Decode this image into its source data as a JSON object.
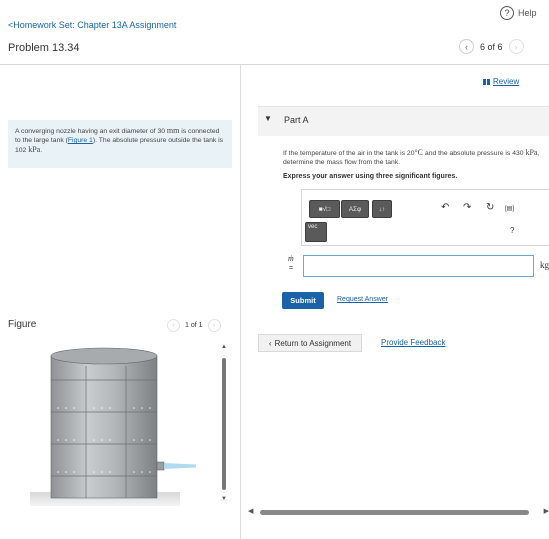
{
  "header": {
    "help_label": "Help",
    "help_icon": "?",
    "breadcrumb": "<Homework Set: Chapter 13A Assignment",
    "problem_title": "Problem 13.34",
    "pager_text": "6 of 6",
    "prev_icon": "‹",
    "next_icon": "›"
  },
  "problem": {
    "text_1": "A converging nozzle having an exit diameter of 30 ",
    "unit_mm": "mm",
    "text_2": " is connected to the large tank (",
    "figure_link": "Figure 1",
    "text_3": "). The absolute pressure outside the tank is 102 ",
    "unit_kpa": "kPa",
    "text_4": "."
  },
  "figure": {
    "label": "Figure",
    "pager_text": "1 of 1",
    "prev_icon": "‹",
    "next_icon": "›"
  },
  "review": {
    "label": "Review"
  },
  "part_a": {
    "caret": "▼",
    "label": "Part A",
    "q_1": "If the temperature of the air in the tank is 20",
    "q_unit_c": "°C",
    "q_2": " and the absolute pressure is 430 ",
    "q_unit_kpa": "kPa",
    "q_3": ", determine the mass flow from the tank.",
    "instruction": "Express your answer using three significant figures."
  },
  "editor": {
    "template_btn": "■√□",
    "greek_btn": "ΑΣφ",
    "arrows_btn": "↓↑",
    "vec_btn": "vec",
    "undo_icon": "↶",
    "redo_icon": "↷",
    "reset_icon": "↻",
    "keyboard_icon": "[▤]",
    "help_icon": "?"
  },
  "answer": {
    "symbol": "ṁ",
    "equals": "=",
    "value": "",
    "unit": "kg"
  },
  "actions": {
    "submit": "Submit",
    "request_answer": "Request Answer",
    "return_label": "Return to Assignment",
    "return_icon": "‹",
    "feedback": "Provide Feedback"
  },
  "scroll": {
    "up": "▲",
    "down": "▼",
    "left": "◀",
    "right": "▶"
  },
  "colors": {
    "link": "#1a63a8",
    "problem_bg": "#e9f2f7",
    "tank": "#b9bcbe",
    "jet": "#a9d6ee"
  }
}
